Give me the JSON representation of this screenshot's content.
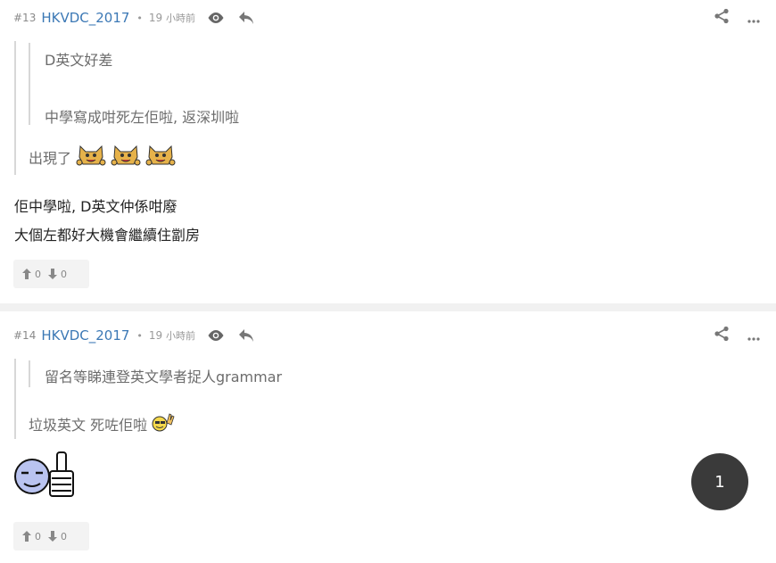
{
  "posts": [
    {
      "number": "#13",
      "username": "HKVDC_2017",
      "separator": "•",
      "time_value": "19",
      "time_unit": "小時前",
      "quote_outer_line": "D英文好差",
      "quote_inner_line": "中學寫成咁死左佢啦, 返深圳啦",
      "quote_reply": "出現了",
      "body_lines": [
        "佢中學啦, D英文仲係咁廢",
        "大個左都好大機會繼續住劏房"
      ],
      "upvotes": "0",
      "downvotes": "0"
    },
    {
      "number": "#14",
      "username": "HKVDC_2017",
      "separator": "•",
      "time_value": "19",
      "time_unit": "小時前",
      "quote_outer_line": "留名等睇連登英文學者捉人grammar",
      "quote_reply": "垃圾英文 死咗佢啦",
      "upvotes": "0",
      "downvotes": "0"
    }
  ],
  "pagination": {
    "current_page": "1"
  },
  "icons": {
    "view": "eye-icon",
    "reply": "reply-arrow-icon",
    "share": "share-icon",
    "more": "more-dots-icon",
    "upvote": "up-arrow-icon",
    "downvote": "down-arrow-icon"
  },
  "colors": {
    "username": "#3b78b5",
    "badge_bg": "#3a3a3a",
    "separator_bg": "#f1f1f1"
  }
}
